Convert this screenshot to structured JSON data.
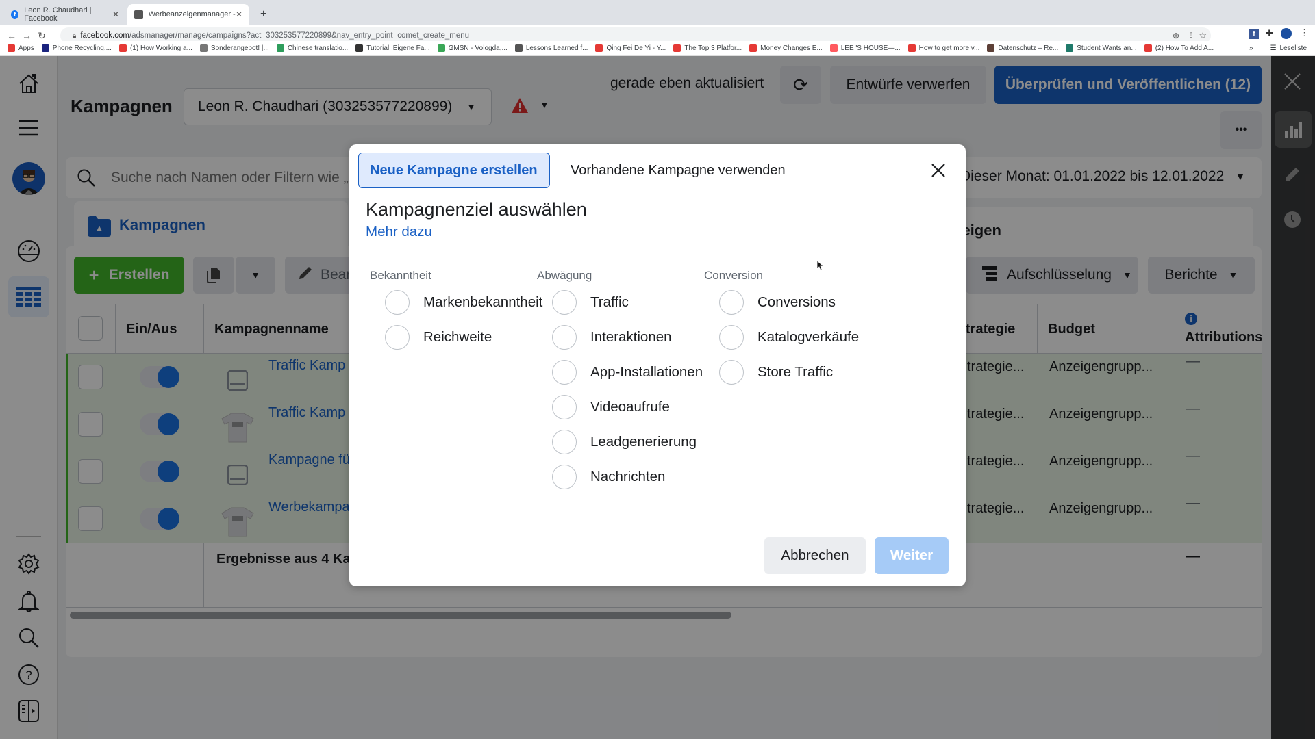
{
  "browser": {
    "tabs": [
      {
        "title": "Leon R. Chaudhari | Facebook",
        "active": false
      },
      {
        "title": "Werbeanzeigenmanager - Wer",
        "active": true
      }
    ],
    "new_tab": "+",
    "url_host": "facebook.com",
    "url_path": "/adsmanager/manage/campaigns?act=303253577220899&nav_entry_point=comet_create_menu",
    "bookmarks": [
      {
        "label": "Apps",
        "color": "#e53935"
      },
      {
        "label": "Phone Recycling,...",
        "color": "#1a237e"
      },
      {
        "label": "(1) How Working a...",
        "color": "#e53935"
      },
      {
        "label": "Sonderangebot! |...",
        "color": "#777777"
      },
      {
        "label": "Chinese translatio...",
        "color": "#2e9d5c"
      },
      {
        "label": "Tutorial: Eigene Fa...",
        "color": "#333333"
      },
      {
        "label": "GMSN - Vologda,...",
        "color": "#3aa757"
      },
      {
        "label": "Lessons Learned f...",
        "color": "#555555"
      },
      {
        "label": "Qing Fei De Yi - Y...",
        "color": "#e53935"
      },
      {
        "label": "The Top 3 Platfor...",
        "color": "#e53935"
      },
      {
        "label": "Money Changes E...",
        "color": "#e53935"
      },
      {
        "label": "LEE 'S HOUSE—...",
        "color": "#ff5a5f"
      },
      {
        "label": "How to get more v...",
        "color": "#e53935"
      },
      {
        "label": "Datenschutz – Re...",
        "color": "#5d4037"
      },
      {
        "label": "Student Wants an...",
        "color": "#1f7a6a"
      },
      {
        "label": "(2) How To Add A...",
        "color": "#e53935"
      }
    ],
    "bookmarks_more": "»",
    "reading_list": "Leseliste"
  },
  "header": {
    "title": "Kampagnen",
    "account": "Leon R. Chaudhari (303253577220899)",
    "status": "gerade eben aktualisiert",
    "discard": "Entwürfe verwerfen",
    "publish": "Überprüfen und Veröffentlichen (12)",
    "more": "•••"
  },
  "search": {
    "placeholder": "Suche nach Namen oder Filtern wie „A",
    "date_range": "Dieser Monat: 01.01.2022 bis 12.01.2022"
  },
  "level_tabs": {
    "campaigns": "Kampagnen",
    "ads": "nzeigen"
  },
  "toolbar": {
    "create": "Erstellen",
    "edit": "Bear",
    "breakdown": "Aufschlüsselung",
    "reports": "Berichte"
  },
  "table": {
    "headers": [
      "Ein/Aus",
      "Kampagnenname",
      "trategie",
      "Budget",
      "Attributions"
    ],
    "rows": [
      {
        "name": "Traffic Kamp",
        "strategy": "trategie...",
        "budget": "Anzeigengrupp...",
        "attribution": "—",
        "thumb": "device"
      },
      {
        "name": "Traffic Kamp",
        "strategy": "trategie...",
        "budget": "Anzeigengrupp...",
        "attribution": "—",
        "thumb": "tshirt"
      },
      {
        "name": "Kampagne fü",
        "strategy": "trategie...",
        "budget": "Anzeigengrupp...",
        "attribution": "—",
        "thumb": "device"
      },
      {
        "name": "Werbekampa",
        "strategy": "trategie...",
        "budget": "Anzeigengrupp...",
        "attribution": "—",
        "thumb": "tshirt"
      }
    ],
    "summary": "Ergebnisse aus 4 Ka",
    "summary_attribution": "—"
  },
  "modal": {
    "tab_new": "Neue Kampagne erstellen",
    "tab_existing": "Vorhandene Kampagne verwenden",
    "title": "Kampagnenziel auswählen",
    "learn_more": "Mehr dazu",
    "columns": [
      {
        "header": "Bekanntheit",
        "options": [
          "Markenbekanntheit",
          "Reichweite"
        ]
      },
      {
        "header": "Abwägung",
        "options": [
          "Traffic",
          "Interaktionen",
          "App-Installationen",
          "Videoaufrufe",
          "Leadgenerierung",
          "Nachrichten"
        ]
      },
      {
        "header": "Conversion",
        "options": [
          "Conversions",
          "Katalogverkäufe",
          "Store Traffic"
        ]
      }
    ],
    "cancel": "Abbrechen",
    "next": "Weiter"
  },
  "colors": {
    "primary_blue": "#1b61c5",
    "create_green": "#42b72a",
    "next_disabled": "#a6cbf7"
  }
}
